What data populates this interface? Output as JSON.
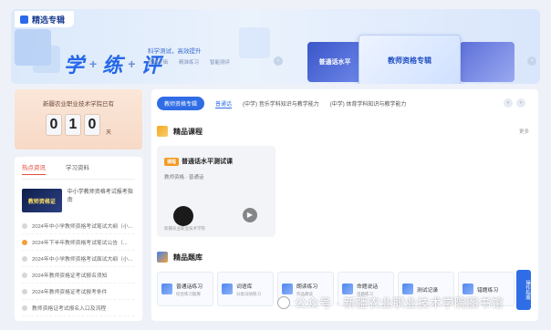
{
  "banner": {
    "title": "精选专辑",
    "slogan": [
      "学",
      "练",
      "评"
    ],
    "slogan_sep": "+",
    "subtitle": "科学测试，高效提升",
    "tags": [
      "精选专辑",
      "精准练习",
      "智能测评"
    ],
    "cards": [
      {
        "label": "普通话水平"
      },
      {
        "label": "教师资格专辑"
      },
      {
        "label": ""
      }
    ],
    "prev_icon": "chevron-left-icon",
    "next_icon": "chevron-right-icon",
    "accent": "#2467e8"
  },
  "counter": {
    "label": "新疆农业职业技术学院已有",
    "digits": [
      "0",
      "1",
      "0"
    ],
    "unit": "天"
  },
  "news": {
    "tabs": [
      "热点资讯",
      "学习资料"
    ],
    "feature": {
      "thumb_text": "教师资格证",
      "text": "中小学教师资格考试报考指南"
    },
    "items": [
      {
        "text": "2024年中小学教师资格考试笔试大纲（小...",
        "hot": false
      },
      {
        "text": "2024年下半年教师资格考试笔试公告（...",
        "hot": true
      },
      {
        "text": "2024年中小学教师资格考试面试大纲（小...",
        "hot": false
      },
      {
        "text": "2024年教师资格证考试报名须知",
        "hot": false
      },
      {
        "text": "2024年教师资格证考试报考条件",
        "hot": false
      },
      {
        "text": "教师资格证考试报名入口及流程",
        "hot": false
      }
    ]
  },
  "main": {
    "categories": [
      {
        "label": "教师资格专辑",
        "state": "active"
      },
      {
        "label": "普通话",
        "state": "blue"
      },
      {
        "label": "(中学) 音乐学科知识与教学能力",
        "state": ""
      },
      {
        "label": "(中学) 体育学科知识与教学能力",
        "state": ""
      }
    ],
    "courses_title": "精品课程",
    "more_label": "更多",
    "course": {
      "tag": "课程",
      "name": "普通话水平测试课",
      "meta": "教师资格 · 普通话",
      "org": "新疆农业职业技术学院"
    },
    "bank_title": "精品题库",
    "bank_items": [
      {
        "label": "普通话练习",
        "sub": "综合练习题库"
      },
      {
        "label": "词语库",
        "sub": "分类词语练习"
      },
      {
        "label": "朗读练习",
        "sub": "作品朗读"
      },
      {
        "label": "命题说话",
        "sub": "话题练习"
      },
      {
        "label": "测试记录",
        "sub": ""
      },
      {
        "label": "错题练习",
        "sub": ""
      }
    ],
    "side_tab": "操作指南"
  },
  "watermark": "公众号 · 新疆农业职业技术学院图书馆"
}
